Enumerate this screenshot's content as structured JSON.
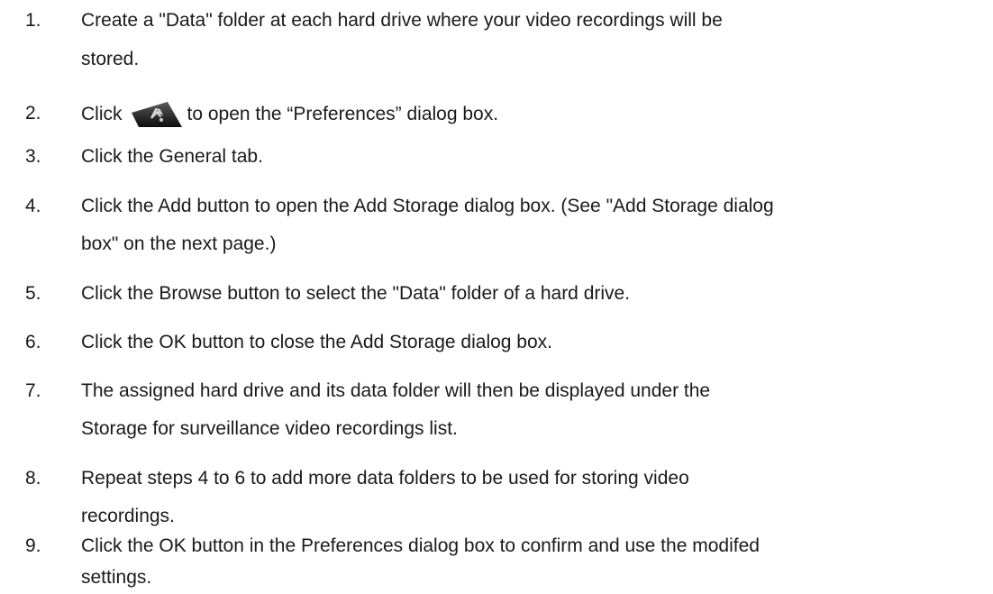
{
  "steps": [
    {
      "num": "1.",
      "lines": [
        "Create a \"Data\" folder at each hard drive where your video recordings will be",
        "stored."
      ]
    },
    {
      "num": "2.",
      "before_icon": "Click",
      "icon": "preferences-tool-icon",
      "after_icon": "to open the “Preferences” dialog box."
    },
    {
      "num": "3.",
      "lines": [
        "Click the General tab."
      ]
    },
    {
      "num": "4.",
      "lines": [
        "Click the Add button to open the Add Storage dialog box. (See \"Add Storage dialog",
        "box\" on the next page.)"
      ]
    },
    {
      "num": "5.",
      "lines": [
        "Click the Browse button to select the \"Data\" folder of a hard drive."
      ]
    },
    {
      "num": "6.",
      "lines": [
        "Click the OK button to close the Add Storage dialog box."
      ]
    },
    {
      "num": "7.",
      "lines": [
        "The assigned hard drive and its data folder will then be displayed under the",
        "Storage for surveillance video recordings list."
      ]
    },
    {
      "num": "8.",
      "lines": [
        "Repeat steps 4 to 6 to add more data folders to be used for storing video",
        "recordings."
      ]
    },
    {
      "num": "9.",
      "lines": [
        "Click the OK button in the Preferences dialog box to confirm and use the modifed",
        "settings."
      ]
    }
  ]
}
